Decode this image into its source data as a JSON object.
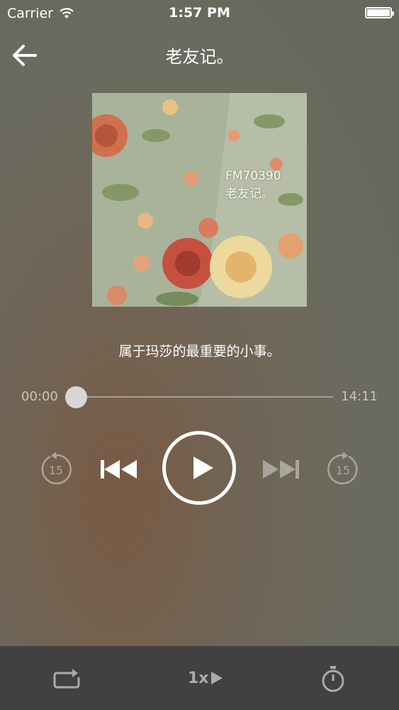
{
  "status": {
    "carrier": "Carrier",
    "time": "1:57 PM"
  },
  "nav": {
    "title": "老友记。"
  },
  "cover": {
    "line1": "FM70390",
    "line2": "老友记。"
  },
  "episode": {
    "title": "属于玛莎的最重要的小事。"
  },
  "player": {
    "elapsed": "00:00",
    "duration": "14:11",
    "progress": 0,
    "skip_seconds": "15"
  },
  "toolbar": {
    "speed_label": "1x"
  },
  "icons": [
    "wifi-icon",
    "battery-icon",
    "back-arrow-icon",
    "rewind-15-icon",
    "previous-icon",
    "play-icon",
    "next-icon",
    "forward-15-icon",
    "repeat-icon",
    "speed-play-icon",
    "timer-icon"
  ]
}
